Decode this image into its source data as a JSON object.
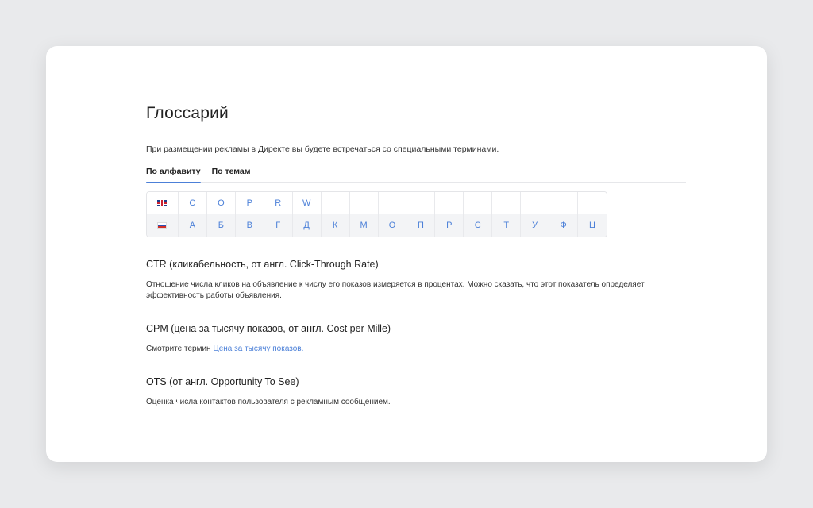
{
  "page": {
    "title": "Глоссарий",
    "intro": "При размещении рекламы в Директе вы будете встречаться со специальными терминами."
  },
  "tabs": [
    {
      "label": "По алфавиту",
      "active": true
    },
    {
      "label": "По темам",
      "active": false
    }
  ],
  "alphabet": {
    "latin_flag": "uk-flag-icon",
    "latin": [
      "C",
      "O",
      "P",
      "R",
      "W"
    ],
    "latin_empty_cells": 10,
    "cyrillic_flag": "ru-flag-icon",
    "cyrillic": [
      "А",
      "Б",
      "В",
      "Г",
      "Д",
      "К",
      "М",
      "О",
      "П",
      "Р",
      "С",
      "Т",
      "У",
      "Ф",
      "Ц"
    ]
  },
  "terms": [
    {
      "title": "CTR (кликабельность, от англ. Click-Through Rate)",
      "description": "Отношение числа кликов на объявление к числу его показов измеряется в процентах. Можно сказать, что этот показатель определяет эффективность работы объявления."
    },
    {
      "title": "CPM (цена за тысячу показов, от англ. Cost per Mille)",
      "description_prefix": "Смотрите термин ",
      "link_text": "Цена за тысячу показов."
    },
    {
      "title": "OTS (от англ. Opportunity To See)",
      "description": "Оценка числа контактов пользователя с рекламным сообщением."
    }
  ],
  "colors": {
    "accent": "#4c80d8",
    "background": "#e9eaec",
    "card": "#ffffff"
  }
}
